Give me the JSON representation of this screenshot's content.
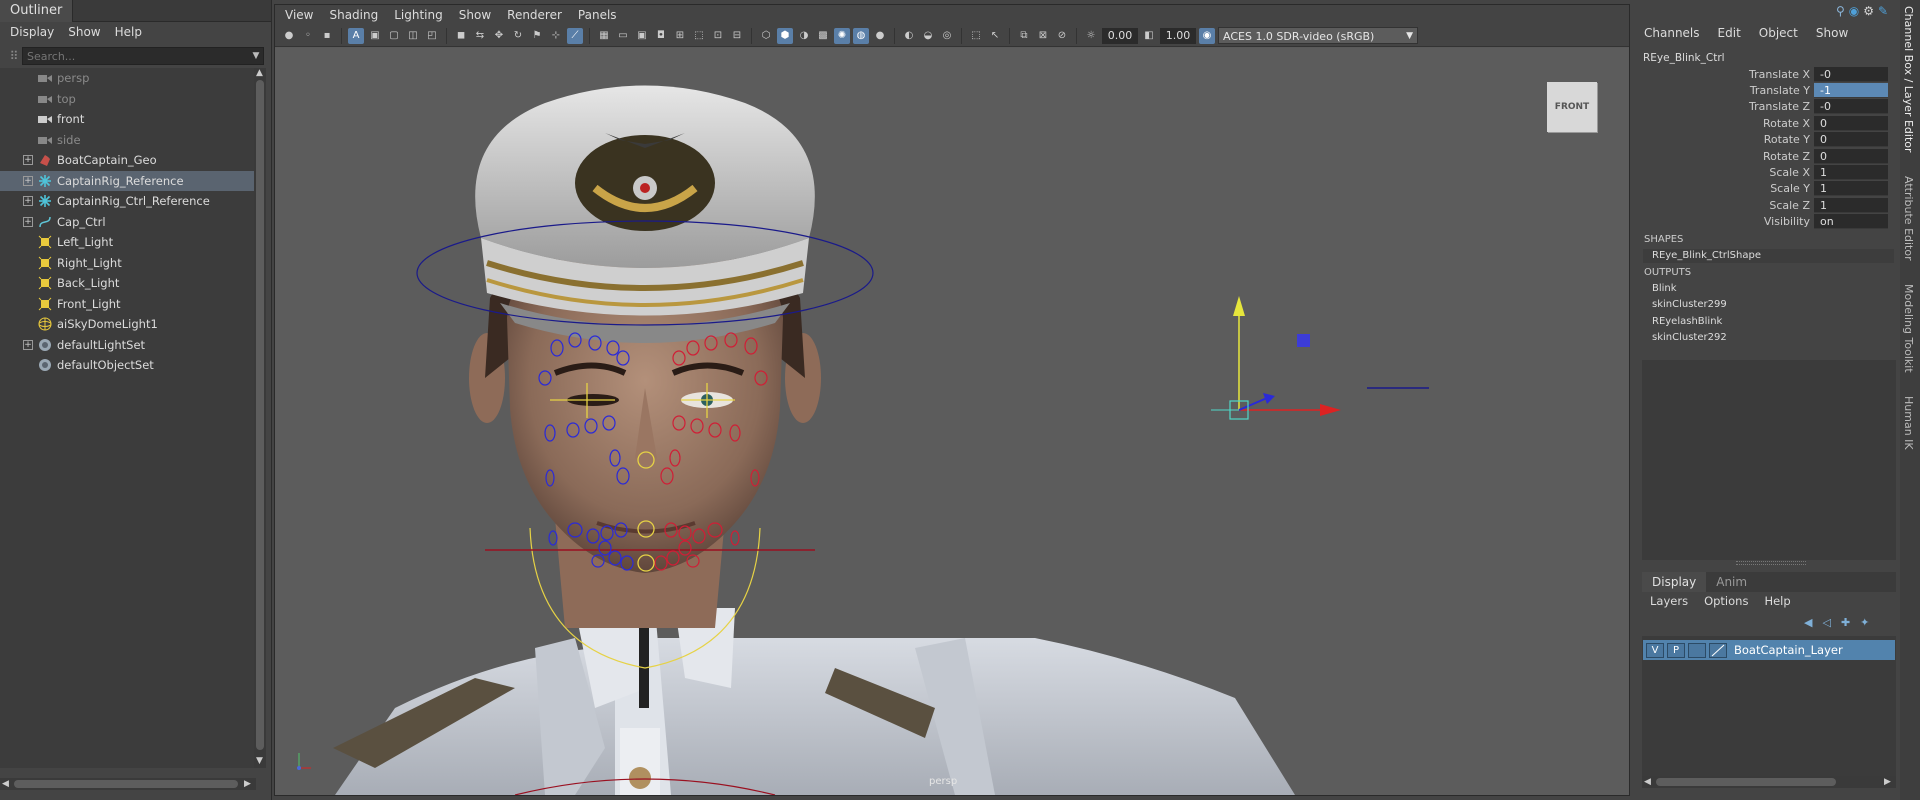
{
  "outliner": {
    "title": "Outliner",
    "menu": [
      "Display",
      "Show",
      "Help"
    ],
    "search_placeholder": "Search...",
    "items": [
      {
        "label": "persp",
        "icon": "camera-icon",
        "dim": true,
        "expand": false,
        "selected": false
      },
      {
        "label": "top",
        "icon": "camera-icon",
        "dim": true,
        "expand": false,
        "selected": false
      },
      {
        "label": "front",
        "icon": "camera-icon",
        "dim": false,
        "expand": false,
        "selected": false
      },
      {
        "label": "side",
        "icon": "camera-icon",
        "dim": true,
        "expand": false,
        "selected": false
      },
      {
        "label": "BoatCaptain_Geo",
        "icon": "mesh-icon",
        "dim": false,
        "expand": true,
        "selected": false
      },
      {
        "label": "CaptainRig_Reference",
        "icon": "reference-icon",
        "dim": false,
        "expand": true,
        "selected": true
      },
      {
        "label": "CaptainRig_Ctrl_Reference",
        "icon": "reference-icon",
        "dim": false,
        "expand": true,
        "selected": false
      },
      {
        "label": "Cap_Ctrl",
        "icon": "curve-icon",
        "dim": false,
        "expand": true,
        "selected": false
      },
      {
        "label": "Left_Light",
        "icon": "light-icon",
        "dim": false,
        "expand": false,
        "selected": false
      },
      {
        "label": "Right_Light",
        "icon": "light-icon",
        "dim": false,
        "expand": false,
        "selected": false
      },
      {
        "label": "Back_Light",
        "icon": "light-icon",
        "dim": false,
        "expand": false,
        "selected": false
      },
      {
        "label": "Front_Light",
        "icon": "light-icon",
        "dim": false,
        "expand": false,
        "selected": false
      },
      {
        "label": "aiSkyDomeLight1",
        "icon": "skydome-icon",
        "dim": false,
        "expand": false,
        "selected": false
      },
      {
        "label": "defaultLightSet",
        "icon": "set-icon",
        "dim": false,
        "expand": true,
        "selected": false
      },
      {
        "label": "defaultObjectSet",
        "icon": "set-icon",
        "dim": false,
        "expand": false,
        "selected": false
      }
    ]
  },
  "viewport": {
    "menu": [
      "View",
      "Shading",
      "Lighting",
      "Show",
      "Renderer",
      "Panels"
    ],
    "exposure_value": "0.00",
    "gamma_value": "1.00",
    "color_space": "ACES 1.0 SDR-video (sRGB)",
    "view_cube_label": "FRONT",
    "camera_label": "persp"
  },
  "channel_box": {
    "menu": [
      "Channels",
      "Edit",
      "Object",
      "Show"
    ],
    "node_name": "REye_Blink_Ctrl",
    "attributes": [
      {
        "label": "Translate X",
        "value": "-0",
        "selected": false
      },
      {
        "label": "Translate Y",
        "value": "-1",
        "selected": true
      },
      {
        "label": "Translate Z",
        "value": "-0",
        "selected": false
      },
      {
        "label": "Rotate X",
        "value": "0",
        "selected": false
      },
      {
        "label": "Rotate Y",
        "value": "0",
        "selected": false
      },
      {
        "label": "Rotate Z",
        "value": "0",
        "selected": false
      },
      {
        "label": "Scale X",
        "value": "1",
        "selected": false
      },
      {
        "label": "Scale Y",
        "value": "1",
        "selected": false
      },
      {
        "label": "Scale Z",
        "value": "1",
        "selected": false
      },
      {
        "label": "Visibility",
        "value": "on",
        "selected": false
      }
    ],
    "shapes_header": "SHAPES",
    "shape_name": "REye_Blink_CtrlShape",
    "outputs_header": "OUTPUTS",
    "outputs": [
      "Blink",
      "skinCluster299",
      "REyelashBlink",
      "skinCluster292"
    ]
  },
  "layer_editor": {
    "tabs": [
      "Display",
      "Anim"
    ],
    "menu": [
      "Layers",
      "Options",
      "Help"
    ],
    "layer": {
      "visible_toggle": "V",
      "playback_toggle": "P",
      "name": "BoatCaptain_Layer"
    }
  },
  "side_tabs": [
    "Channel Box / Layer Editor",
    "Attribute Editor",
    "Modeling Toolkit",
    "Human IK"
  ],
  "colors": {
    "selection_blue": "#5283ad",
    "attr_highlight": "#5c89b5",
    "control_blue": "#2a2ad8",
    "control_red": "#d01e36",
    "control_yellow": "#e6d245"
  }
}
